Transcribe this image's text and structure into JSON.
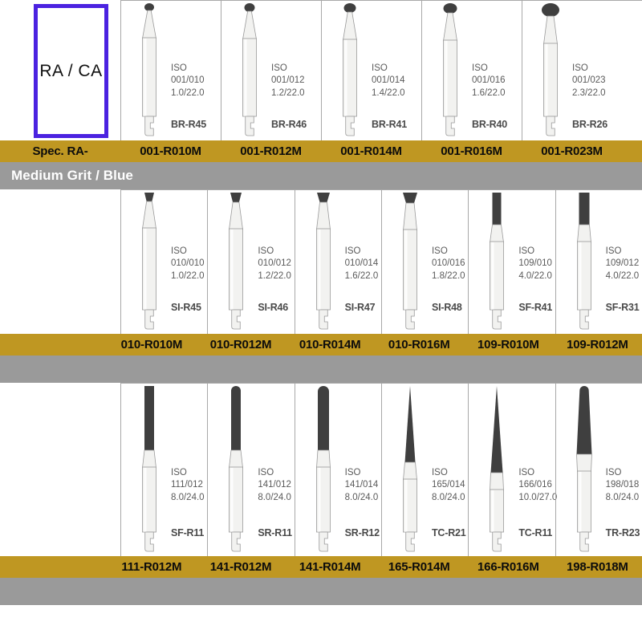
{
  "legend": {
    "ra_ca_label": "RA / CA",
    "box_color": "#4b22e0"
  },
  "colors": {
    "gold_bar": "#bf9722",
    "gray_bar": "#9a9a9a",
    "grit_color": "#3f3f3f",
    "shank": "#f2f2f0",
    "grid_line": "#a8a8a8"
  },
  "sections": [
    {
      "row_label_first_cell": "Spec. RA-",
      "banner": null,
      "items": [
        {
          "iso_top": "ISO",
          "iso_code": "001/010",
          "iso_dims": "1.0/22.0",
          "code": "BR-R45",
          "order": "001-R010M",
          "shape": "round",
          "head_w": 12,
          "head_h": 10
        },
        {
          "iso_top": "ISO",
          "iso_code": "001/012",
          "iso_dims": "1.2/22.0",
          "code": "BR-R46",
          "order": "001-R012M",
          "shape": "round",
          "head_w": 13,
          "head_h": 11
        },
        {
          "iso_top": "ISO",
          "iso_code": "001/014",
          "iso_dims": "1.4/22.0",
          "code": "BR-R41",
          "order": "001-R014M",
          "shape": "round",
          "head_w": 15,
          "head_h": 12
        },
        {
          "iso_top": "ISO",
          "iso_code": "001/016",
          "iso_dims": "1.6/22.0",
          "code": "BR-R40",
          "order": "001-R016M",
          "shape": "round",
          "head_w": 17,
          "head_h": 13
        },
        {
          "iso_top": "ISO",
          "iso_code": "001/023",
          "iso_dims": "2.3/22.0",
          "code": "BR-R26",
          "order": "001-R023M",
          "shape": "round",
          "head_w": 22,
          "head_h": 17
        }
      ]
    },
    {
      "row_label_first_cell": "",
      "banner": "Medium Grit / Blue",
      "items": [
        {
          "iso_top": "ISO",
          "iso_code": "010/010",
          "iso_dims": "1.0/22.0",
          "code": "SI-R45",
          "order": "010-R010M",
          "shape": "inverted-cone",
          "head_w": 12,
          "head_h": 11
        },
        {
          "iso_top": "ISO",
          "iso_code": "010/012",
          "iso_dims": "1.2/22.0",
          "code": "SI-R46",
          "order": "010-R012M",
          "shape": "inverted-cone",
          "head_w": 14,
          "head_h": 12
        },
        {
          "iso_top": "ISO",
          "iso_code": "010/014",
          "iso_dims": "1.6/22.0",
          "code": "SI-R47",
          "order": "010-R014M",
          "shape": "inverted-cone",
          "head_w": 16,
          "head_h": 12
        },
        {
          "iso_top": "ISO",
          "iso_code": "010/016",
          "iso_dims": "1.8/22.0",
          "code": "SI-R48",
          "order": "010-R016M",
          "shape": "inverted-cone",
          "head_w": 18,
          "head_h": 13
        },
        {
          "iso_top": "ISO",
          "iso_code": "109/010",
          "iso_dims": "4.0/22.0",
          "code": "SF-R41",
          "order": "109-R010M",
          "shape": "cylinder",
          "head_w": 11,
          "head_h": 40
        },
        {
          "iso_top": "ISO",
          "iso_code": "109/012",
          "iso_dims": "4.0/22.0",
          "code": "SF-R31",
          "order": "109-R012M",
          "shape": "cylinder",
          "head_w": 13,
          "head_h": 40
        }
      ]
    },
    {
      "row_label_first_cell": "",
      "banner": null,
      "items": [
        {
          "iso_top": "ISO",
          "iso_code": "111/012",
          "iso_dims": "8.0/24.0",
          "code": "SF-R11",
          "order": "111-R012M",
          "shape": "long-cylinder",
          "head_w": 12,
          "head_h": 80
        },
        {
          "iso_top": "ISO",
          "iso_code": "141/012",
          "iso_dims": "8.0/24.0",
          "code": "SR-R11",
          "order": "141-R012M",
          "shape": "round-end-cylinder",
          "head_w": 12,
          "head_h": 80
        },
        {
          "iso_top": "ISO",
          "iso_code": "141/014",
          "iso_dims": "8.0/24.0",
          "code": "SR-R12",
          "order": "141-R014M",
          "shape": "round-end-cylinder",
          "head_w": 14,
          "head_h": 80
        },
        {
          "iso_top": "ISO",
          "iso_code": "165/014",
          "iso_dims": "8.0/24.0",
          "code": "TC-R21",
          "order": "165-R014M",
          "shape": "needle",
          "head_w": 13,
          "head_h": 95
        },
        {
          "iso_top": "ISO",
          "iso_code": "166/016",
          "iso_dims": "10.0/27.0",
          "code": "TC-R11",
          "order": "166-R016M",
          "shape": "needle",
          "head_w": 15,
          "head_h": 108
        },
        {
          "iso_top": "ISO",
          "iso_code": "198/018",
          "iso_dims": "8.0/24.0",
          "code": "TR-R23",
          "order": "198-R018M",
          "shape": "taper-round",
          "head_w": 19,
          "head_h": 85
        }
      ]
    }
  ]
}
